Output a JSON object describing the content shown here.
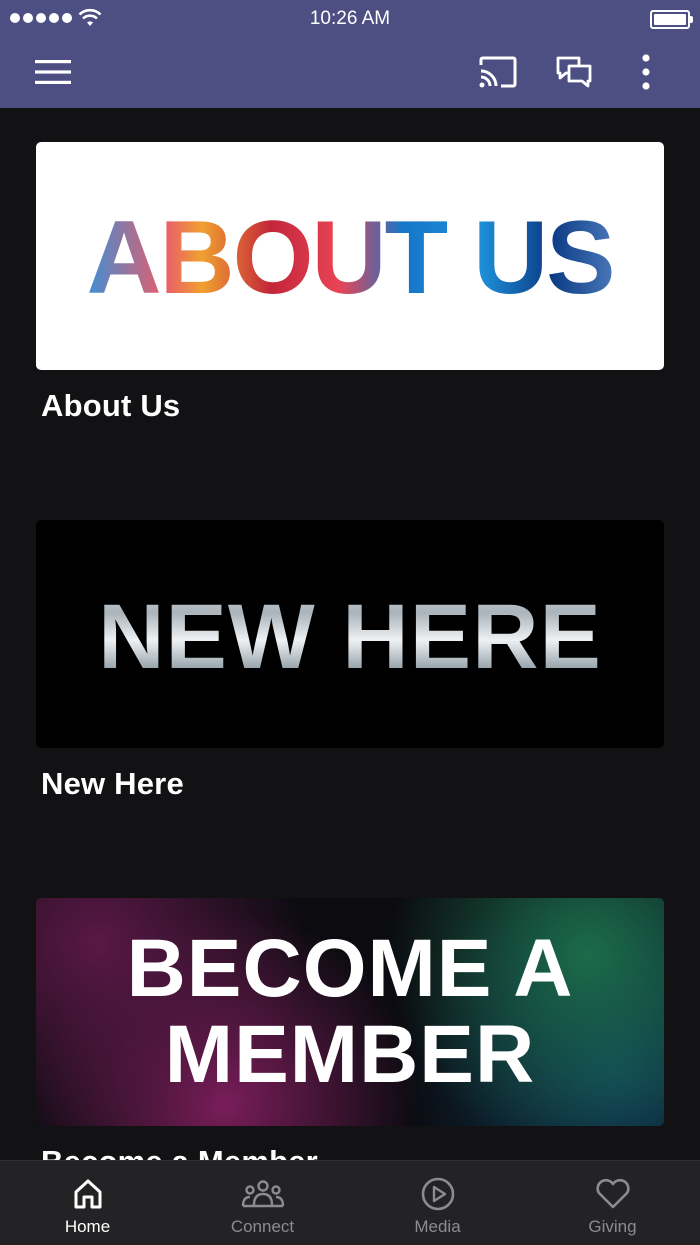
{
  "status_bar": {
    "time": "10:26 AM",
    "signal_icon": "signal-dots-icon",
    "wifi_icon": "wifi-icon",
    "battery_icon": "battery-icon"
  },
  "toolbar": {
    "background": "#4d4f83",
    "icons": [
      "hamburger-menu-icon",
      "cast-icon",
      "chat-icon",
      "more-vertical-icon"
    ]
  },
  "cards": [
    {
      "title": "About Us",
      "image_text": "ABOUT US"
    },
    {
      "title": "New Here",
      "image_text": "NEW HERE"
    },
    {
      "title": "Become a Member",
      "image_text_line1": "BECOME A",
      "image_text_line2": "MEMBER"
    }
  ],
  "tabs": [
    {
      "label": "Home",
      "icon": "home-icon",
      "active": true
    },
    {
      "label": "Connect",
      "icon": "people-icon",
      "active": false
    },
    {
      "label": "Media",
      "icon": "play-circle-icon",
      "active": false
    },
    {
      "label": "Giving",
      "icon": "heart-icon",
      "active": false
    }
  ],
  "colors": {
    "background": "#121214",
    "tab_bar": "#232325",
    "active_tab": "#ffffff",
    "inactive_tab": "#8c8c90"
  }
}
